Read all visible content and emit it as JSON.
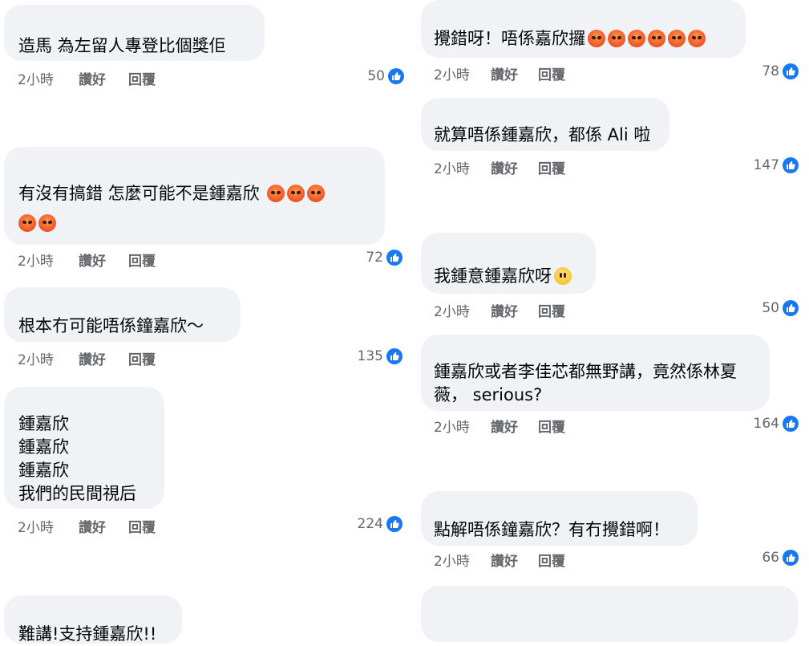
{
  "comments_left": [
    {
      "lines": [
        "造馬 為左留人專登比個獎佢"
      ],
      "time": "2小時",
      "like": "讚好",
      "reply": "回覆",
      "count": "50"
    },
    {
      "lines": [
        "有沒有搞錯 怎麼可能不是鍾嘉欣 "
      ],
      "time": "2小時",
      "like": "讚好",
      "reply": "回覆",
      "count": "72",
      "emoji": "angry-face-icon"
    },
    {
      "lines": [
        "根本冇可能唔係鐘嘉欣～"
      ],
      "time": "2小時",
      "like": "讚好",
      "reply": "回覆",
      "count": "135"
    },
    {
      "lines": [
        "鍾嘉欣",
        "鍾嘉欣",
        "鍾嘉欣",
        "我們的民間視后"
      ],
      "time": "2小時",
      "like": "讚好",
      "reply": "回覆",
      "count": "224"
    },
    {
      "lines": [
        "難講!支持鍾嘉欣!!"
      ]
    }
  ],
  "comments_right": [
    {
      "lines": [
        "攪錯呀！唔係嘉欣攞"
      ],
      "time": "2小時",
      "like": "讚好",
      "reply": "回覆",
      "count": "78",
      "emoji": "angry-face-icon"
    },
    {
      "lines": [
        "就算唔係鍾嘉欣，都係 Ali 啦"
      ],
      "time": "2小時",
      "like": "讚好",
      "reply": "回覆",
      "count": "147"
    },
    {
      "lines": [
        "我鍾意鍾嘉欣呀"
      ],
      "time": "2小時",
      "like": "讚好",
      "reply": "回覆",
      "count": "50",
      "emoji": "neutral-face-icon"
    },
    {
      "lines": [
        "鍾嘉欣或者李佳芯都無野講，竟然係林夏",
        "薇， serious?"
      ],
      "time": "2小時",
      "like": "讚好",
      "reply": "回覆",
      "count": "164"
    },
    {
      "lines": [
        "點解唔係鐘嘉欣？有冇攪錯啊！"
      ],
      "time": "2小時",
      "like": "讚好",
      "reply": "回覆",
      "count": "66"
    }
  ],
  "colors": {
    "bubble": "#f0f2f5",
    "meta": "#65676b",
    "like_badge": "#1877f2"
  }
}
